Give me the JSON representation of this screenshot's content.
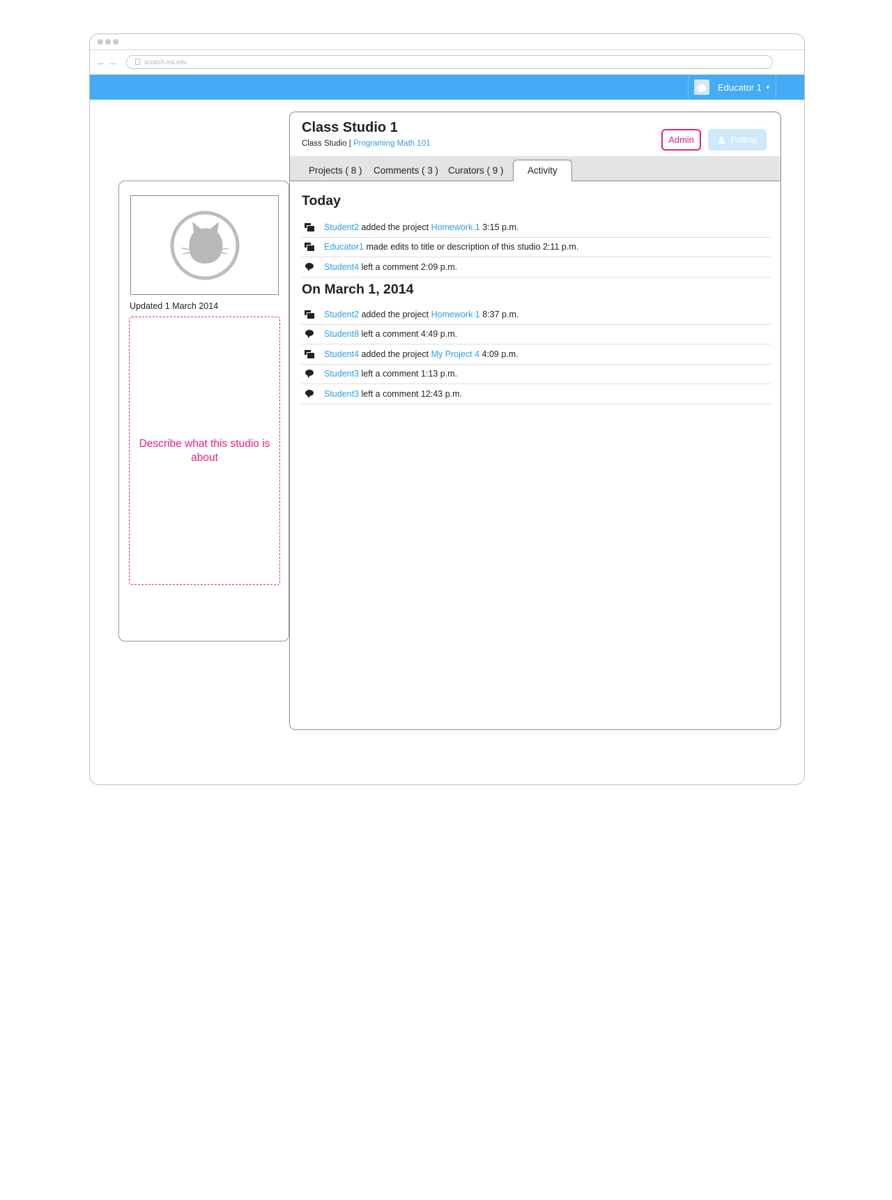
{
  "browser": {
    "url": "scratch.mit.edu"
  },
  "header": {
    "username": "Educator 1"
  },
  "sidebar": {
    "updated": "Updated 1 March 2014",
    "description_placeholder": "Describe what this studio is about"
  },
  "studio": {
    "title": "Class Studio 1",
    "type": "Class Studio",
    "separator": " | ",
    "class_link": "Programing Math 101",
    "admin_label": "Admin",
    "follow_label": "Follow"
  },
  "tabs": [
    {
      "label": "Projects ( 8 )"
    },
    {
      "label": "Comments ( 3 )"
    },
    {
      "label": "Curators ( 9 )"
    },
    {
      "label": "Activity"
    }
  ],
  "activity": {
    "sections": [
      {
        "heading": "Today",
        "items": [
          {
            "icon": "project-icon",
            "user": "Student2",
            "text": " added the project ",
            "target": "Homework 1",
            "time": " 3:15 p.m."
          },
          {
            "icon": "project-icon",
            "user": "Educator1",
            "text": " made edits to title or description of this studio 2:11 p.m.",
            "target": "",
            "time": ""
          },
          {
            "icon": "comment-icon",
            "user": "Student4",
            "text": " left a comment 2:09 p.m.",
            "target": "",
            "time": ""
          }
        ]
      },
      {
        "heading": "On March 1, 2014",
        "items": [
          {
            "icon": "project-icon",
            "user": "Student2",
            "text": " added the project ",
            "target": "Homework 1",
            "time": " 8:37 p.m."
          },
          {
            "icon": "comment-icon",
            "user": "Student8",
            "text": " left a comment 4:49 p.m.",
            "target": "",
            "time": ""
          },
          {
            "icon": "project-icon",
            "user": "Student4",
            "text": " added the project ",
            "target": "My Project 4",
            "time": " 4:09 p.m."
          },
          {
            "icon": "comment-icon",
            "user": "Student3",
            "text": " left a comment 1:13 p.m.",
            "target": "",
            "time": ""
          },
          {
            "icon": "comment-icon",
            "user": "Student3",
            "text": " left a comment 12:43 p.m.",
            "target": "",
            "time": ""
          }
        ]
      }
    ]
  },
  "colors": {
    "brand_blue": "#44abf4",
    "link_blue": "#2d9ee6",
    "accent_pink": "#e5237b"
  }
}
